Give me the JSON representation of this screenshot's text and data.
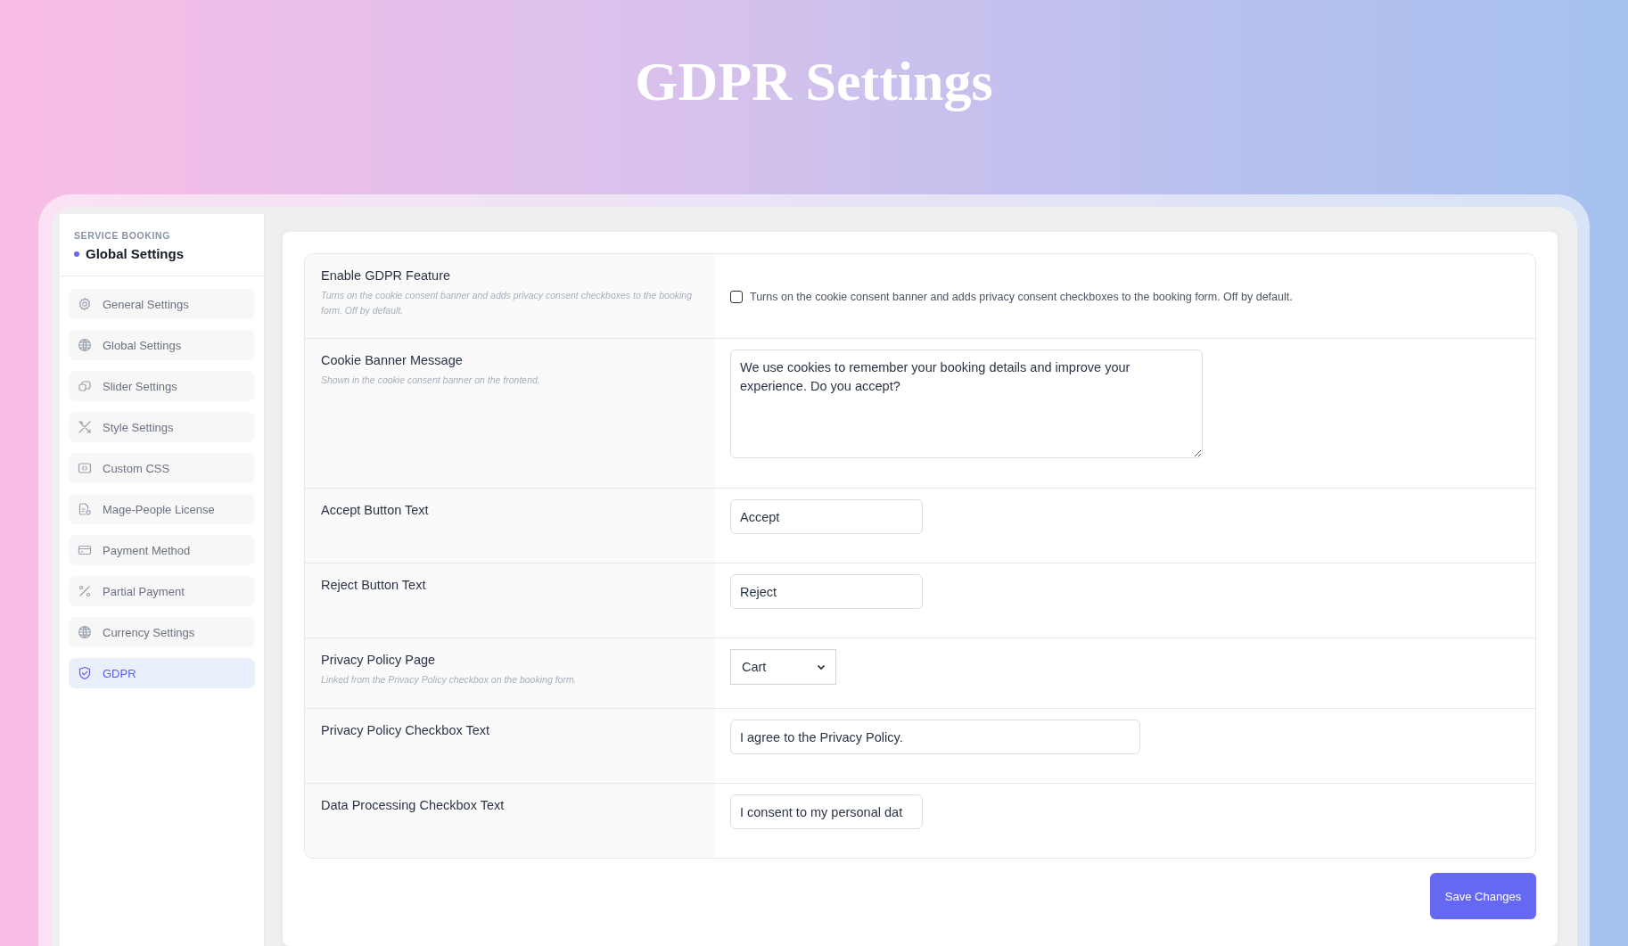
{
  "page_title": "GDPR Settings",
  "sidebar": {
    "eyebrow": "SERVICE BOOKING",
    "heading": "Global Settings",
    "items": [
      {
        "label": "General Settings",
        "selected": false
      },
      {
        "label": "Global Settings",
        "selected": false
      },
      {
        "label": "Slider Settings",
        "selected": false
      },
      {
        "label": "Style Settings",
        "selected": false
      },
      {
        "label": "Custom CSS",
        "selected": false
      },
      {
        "label": "Mage-People License",
        "selected": false
      },
      {
        "label": "Payment Method",
        "selected": false
      },
      {
        "label": "Partial Payment",
        "selected": false
      },
      {
        "label": "Currency Settings",
        "selected": false
      },
      {
        "label": "GDPR",
        "selected": true
      }
    ]
  },
  "settings": [
    {
      "label": "Enable GDPR Feature",
      "description": "Turns on the cookie consent banner and adds privacy consent checkboxes to the booking form. Off by default.",
      "kind": "checkbox",
      "checked": false,
      "caption": "Turns on the cookie consent banner and adds privacy consent checkboxes to the booking form. Off by default."
    },
    {
      "label": "Cookie Banner Message",
      "description": "Shown in the cookie consent banner on the frontend.",
      "kind": "textarea",
      "value": "We use cookies to remember your booking details and improve your experience. Do you accept?"
    },
    {
      "label": "Accept Button Text",
      "kind": "text",
      "value": "Accept"
    },
    {
      "label": "Reject Button Text",
      "kind": "text",
      "value": "Reject"
    },
    {
      "label": "Privacy Policy Page",
      "description": "Linked from the Privacy Policy checkbox on the booking form.",
      "kind": "select",
      "value": "Cart"
    },
    {
      "label": "Privacy Policy Checkbox Text",
      "kind": "wide-text",
      "value": "I agree to the Privacy Policy."
    },
    {
      "label": "Data Processing Checkbox Text",
      "kind": "text",
      "value": "I consent to my personal dat"
    }
  ],
  "save_button": "Save Changes"
}
